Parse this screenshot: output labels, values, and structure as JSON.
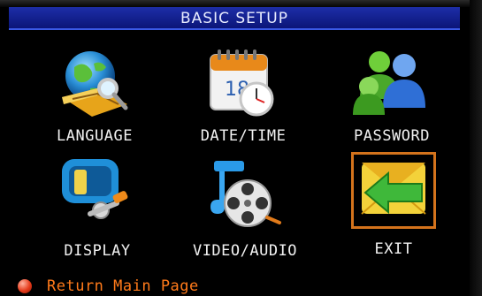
{
  "window": {
    "title": "BASIC SETUP"
  },
  "menu": {
    "items": [
      {
        "label": "LANGUAGE",
        "icon": "language-globe-icon"
      },
      {
        "label": "DATE/TIME",
        "icon": "calendar-clock-icon"
      },
      {
        "label": "PASSWORD",
        "icon": "users-icon"
      },
      {
        "label": "DISPLAY",
        "icon": "display-settings-icon"
      },
      {
        "label": "VIDEO/AUDIO",
        "icon": "film-music-icon"
      },
      {
        "label": "EXIT",
        "icon": "exit-arrow-icon"
      }
    ],
    "selected": "EXIT"
  },
  "footer": {
    "text": "Return Main Page"
  },
  "colors": {
    "title_bar": "#1428a0",
    "selection": "#d4731c",
    "footer_text": "#ff7a1a"
  }
}
